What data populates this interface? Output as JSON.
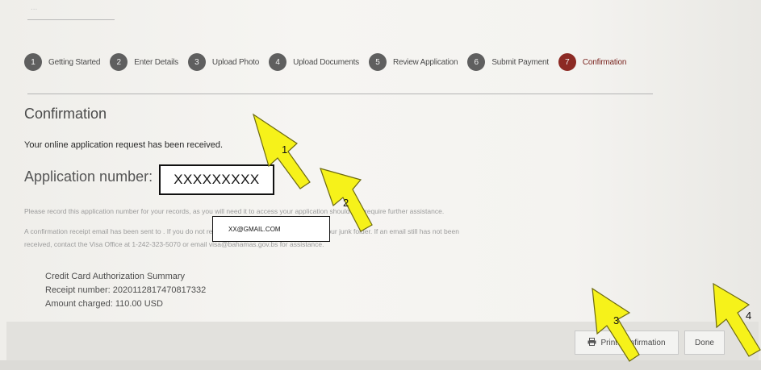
{
  "header": {
    "faded_text": "..."
  },
  "steps": [
    {
      "num": "1",
      "label": "Getting Started"
    },
    {
      "num": "2",
      "label": "Enter Details"
    },
    {
      "num": "3",
      "label": "Upload Photo"
    },
    {
      "num": "4",
      "label": "Upload Documents"
    },
    {
      "num": "5",
      "label": "Review Application"
    },
    {
      "num": "6",
      "label": "Submit Payment"
    },
    {
      "num": "7",
      "label": "Confirmation"
    }
  ],
  "main": {
    "title": "Confirmation",
    "received": "Your online application request has been received.",
    "app_label": "Application number:",
    "app_number": "XXXXXXXXX",
    "record_note": "Please record this application number for your records, as you will need it to access your application should you require further assistance.",
    "conf_line1": "A confirmation receipt email has been sent to                                    . If you do not receive an email shortly, please check your junk folder. If an email still has not been",
    "conf_line2": "received, contact the Visa Office at 1-242-323-5070 or email visa@bahamas.gov.bs for assistance.",
    "email": "XX@GMAIL.COM"
  },
  "summary": {
    "heading": "Credit Card Authorization Summary",
    "receipt": "Receipt number: 2020112817470817332",
    "amount": "Amount charged: 110.00 USD"
  },
  "buttons": {
    "print": "Print Confirmation",
    "done": "Done"
  },
  "annotations": [
    {
      "num": "1"
    },
    {
      "num": "2"
    },
    {
      "num": "3"
    },
    {
      "num": "4"
    }
  ],
  "colors": {
    "active_step": "#8c2a24",
    "step": "#5f5f5f",
    "arrow": "#f6f21a"
  }
}
